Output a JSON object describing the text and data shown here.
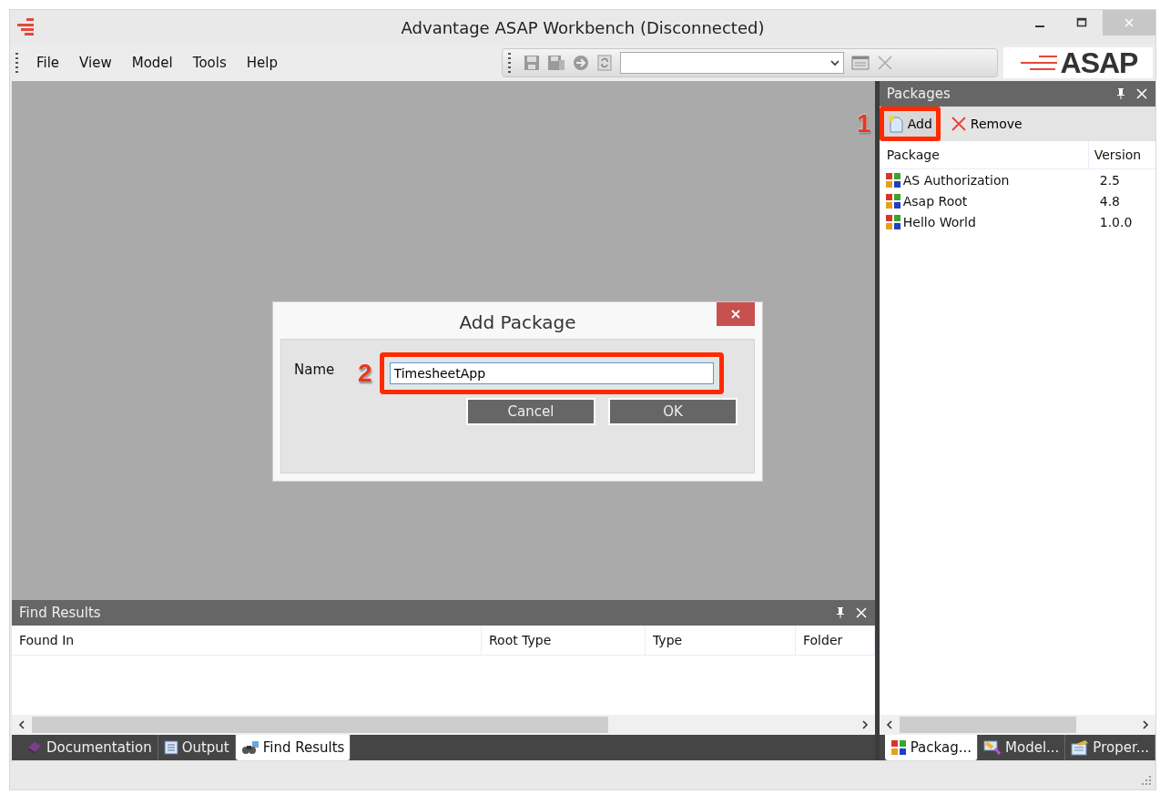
{
  "window": {
    "title": "Advantage ASAP Workbench (Disconnected)"
  },
  "menu": [
    "File",
    "View",
    "Model",
    "Tools",
    "Help"
  ],
  "logo": {
    "text": "ASAP"
  },
  "packages_panel": {
    "title": "Packages",
    "actions": [
      {
        "label": "Add",
        "kind": "add",
        "highlighted": true,
        "callout": "1"
      },
      {
        "label": "Remove",
        "kind": "remove",
        "highlighted": false
      }
    ],
    "columns": [
      "Package",
      "Version"
    ],
    "rows": [
      {
        "name": "AS Authorization",
        "version": "2.5"
      },
      {
        "name": "Asap Root",
        "version": "4.8"
      },
      {
        "name": "Hello World",
        "version": "1.0.0"
      }
    ]
  },
  "dialog": {
    "title": "Add Package",
    "name_label": "Name",
    "name_value": "TimesheetApp",
    "callout": "2",
    "field_highlighted": true,
    "buttons": [
      "Cancel",
      "OK"
    ]
  },
  "find_results": {
    "title": "Find Results",
    "columns": [
      "Found In",
      "Root Type",
      "Type",
      "Folder"
    ]
  },
  "bottom_tabs": [
    {
      "label": "Documentation",
      "kind": "book",
      "selected": false
    },
    {
      "label": "Output",
      "kind": "list",
      "selected": false
    },
    {
      "label": "Find Results",
      "kind": "binoculars",
      "selected": true
    }
  ],
  "right_tabs": [
    {
      "label": "Packag...",
      "kind": "blocks",
      "selected": true
    },
    {
      "label": "Model...",
      "kind": "model",
      "selected": false
    },
    {
      "label": "Proper...",
      "kind": "props",
      "selected": false
    }
  ]
}
